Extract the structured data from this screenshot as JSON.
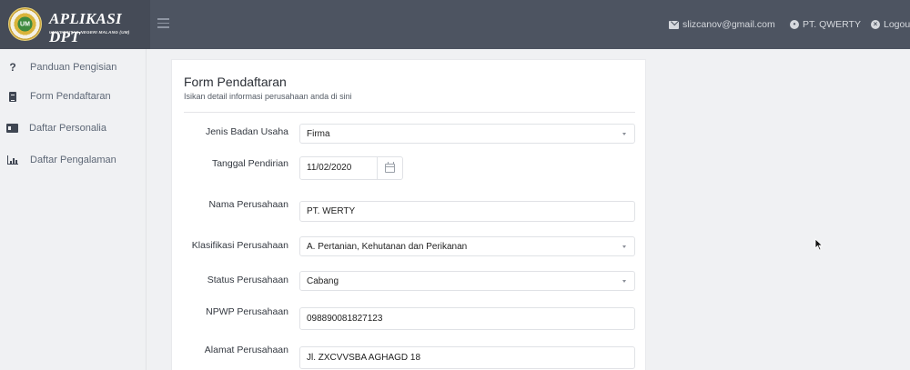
{
  "header": {
    "brand_title": "APLIKASI DPT",
    "brand_subtitle": "UNIVERSITAS NEGERI MALANG (UM)",
    "logo_text": "UM",
    "email": "slizcanov@gmail.com",
    "company": "PT. QWERTY",
    "logout_label": "Logout"
  },
  "sidebar": {
    "items": [
      {
        "label": "Panduan Pengisian",
        "icon": "question-icon"
      },
      {
        "label": "Form Pendaftaran",
        "icon": "document-icon"
      },
      {
        "label": "Daftar Personalia",
        "icon": "id-card-icon"
      },
      {
        "label": "Daftar Pengalaman",
        "icon": "chart-icon"
      }
    ]
  },
  "form": {
    "title": "Form Pendaftaran",
    "subtitle": "Isikan detail informasi perusahaan anda di sini",
    "fields": {
      "jenis_badan_usaha": {
        "label": "Jenis Badan Usaha",
        "value": "Firma"
      },
      "tanggal_pendirian": {
        "label": "Tanggal Pendirian",
        "value": "11/02/2020"
      },
      "nama_perusahaan": {
        "label": "Nama Perusahaan",
        "value": "PT. WERTY"
      },
      "klasifikasi_perusahaan": {
        "label": "Klasifikasi Perusahaan",
        "value": "A. Pertanian, Kehutanan dan Perikanan"
      },
      "status_perusahaan": {
        "label": "Status Perusahaan",
        "value": "Cabang"
      },
      "npwp_perusahaan": {
        "label": "NPWP Perusahaan",
        "value": "098890081827123"
      },
      "alamat_perusahaan": {
        "label": "Alamat Perusahaan",
        "value": "Jl. ZXCVVSBA AGHAGD 18"
      }
    }
  },
  "colors": {
    "topbar": "#4d5461",
    "sidebar_bg": "#f0f1f3",
    "panel_bg": "#ffffff",
    "nav_text": "#5d6776"
  }
}
